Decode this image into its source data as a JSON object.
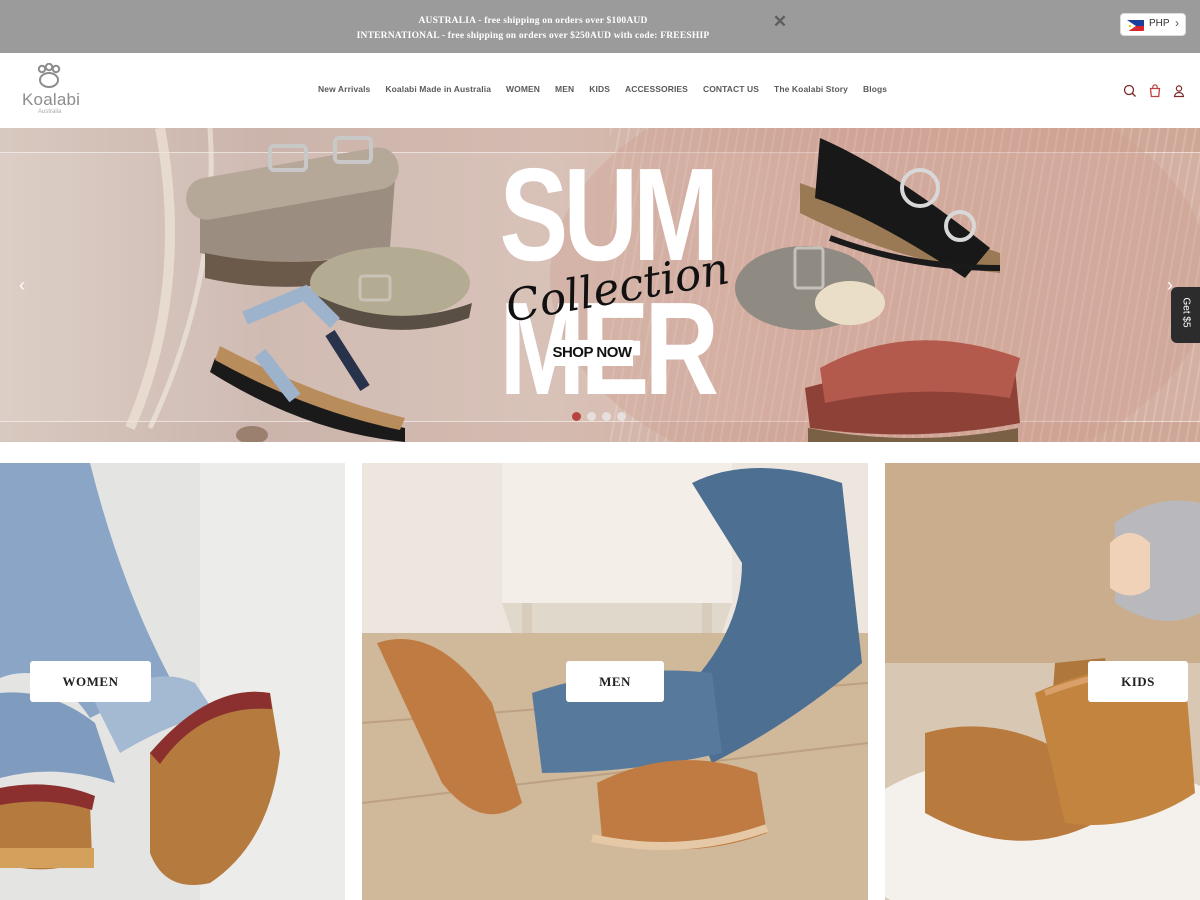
{
  "announcement": {
    "line1": "AUSTRALIA - free shipping on orders over $100AUD",
    "line2": "INTERNATIONAL - free shipping on orders over $250AUD with code: FREESHIP",
    "close_glyph": "✕"
  },
  "currency": {
    "code": "PHP",
    "flag": "philippines-flag-icon",
    "chevron": "›"
  },
  "logo": {
    "word": "Koalabi",
    "sub": "Australia",
    "trademark": "."
  },
  "nav": [
    {
      "label": "New Arrivals"
    },
    {
      "label": "Koalabi Made in Australia"
    },
    {
      "label": "WOMEN"
    },
    {
      "label": "MEN"
    },
    {
      "label": "KIDS"
    },
    {
      "label": "ACCESSORIES"
    },
    {
      "label": "CONTACT US"
    },
    {
      "label": "The Koalabi Story"
    },
    {
      "label": "Blogs"
    }
  ],
  "header_icons": [
    "search-icon",
    "bag-icon",
    "account-icon"
  ],
  "hero": {
    "headline_top": "SUM",
    "headline_bottom": "MER",
    "script_text": "Collection",
    "cta": "SHOP NOW",
    "prev_glyph": "‹",
    "next_glyph": "›",
    "slide_count": 4,
    "active_slide": 1
  },
  "reward_tab": {
    "label": "Get $5"
  },
  "categories": [
    {
      "label": "WOMEN"
    },
    {
      "label": "MEN"
    },
    {
      "label": "KIDS"
    }
  ],
  "colors": {
    "announcement_bg": "#9b9b9b",
    "accent": "#b9433e",
    "nav_text": "#5a5a5a",
    "hero_bg": "#cfb3a8"
  }
}
